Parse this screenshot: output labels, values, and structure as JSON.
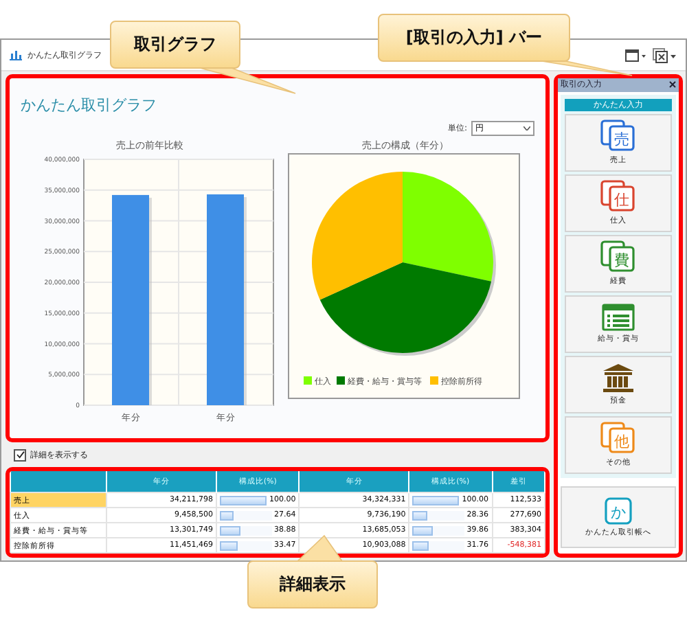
{
  "window": {
    "title": "かんたん取引グラフ"
  },
  "graph_panel": {
    "heading": "かんたん取引グラフ",
    "unit_label": "単位:",
    "unit_select": "円",
    "bar_chart": {
      "title": "売上の前年比較",
      "chart_data": {
        "type": "bar",
        "stacked": false,
        "grid": true,
        "categories": [
          "年分",
          "年分"
        ],
        "ylim": [
          0,
          40000000
        ],
        "yticks": [
          {
            "value": 0,
            "label": "0"
          },
          {
            "value": 5000000,
            "label": "5,000,000"
          },
          {
            "value": 10000000,
            "label": "10,000,000"
          },
          {
            "value": 15000000,
            "label": "15,000,000"
          },
          {
            "value": 20000000,
            "label": "20,000,000"
          },
          {
            "value": 25000000,
            "label": "25,000,000"
          },
          {
            "value": 30000000,
            "label": "30,000,000"
          },
          {
            "value": 35000000,
            "label": "35,000,000"
          },
          {
            "value": 40000000,
            "label": "40,000,000"
          }
        ],
        "series": [
          {
            "color": "#3f8fe6",
            "values": [
              34200000,
              34300000
            ]
          }
        ]
      }
    },
    "pie_chart": {
      "title": "売上の構成（年分）",
      "chart_data": {
        "type": "pie",
        "legend": "bottom",
        "categories": [
          "仕入",
          "経費・給与・賞与等",
          "控除前所得"
        ],
        "values": [
          28.36,
          39.86,
          31.76
        ],
        "colors": [
          "#7fff00",
          "#007a00",
          "#ffbf00"
        ]
      }
    }
  },
  "show_details": {
    "label": "詳細を表示する",
    "checked": true
  },
  "detail_table": {
    "columns": [
      "年分",
      "構成比(%)",
      "年分",
      "構成比(%)",
      "差引"
    ],
    "rows": [
      {
        "label": "売上",
        "selected": true,
        "prior": "34,211,798",
        "prior_ratio": "100.00",
        "prior_bar": {
          "level": 1
        },
        "current": "34,324,331",
        "current_ratio": "100.00",
        "current_bar": {
          "level": 1
        },
        "difference": "112,533",
        "negative": false
      },
      {
        "label": "仕入",
        "selected": false,
        "prior": "9,458,500",
        "prior_ratio": "27.64",
        "prior_bar": {
          "level": 0.2764
        },
        "current": "9,736,190",
        "current_ratio": "28.36",
        "current_bar": {
          "level": 0.2836
        },
        "difference": "277,690",
        "negative": false
      },
      {
        "label": "経費・給与・賞与等",
        "selected": false,
        "prior": "13,301,749",
        "prior_ratio": "38.88",
        "prior_bar": {
          "level": 0.3888
        },
        "current": "13,685,053",
        "current_ratio": "39.86",
        "current_bar": {
          "level": 0.3986
        },
        "difference": "383,304",
        "negative": false
      },
      {
        "label": "控除前所得",
        "selected": false,
        "prior": "11,451,469",
        "prior_ratio": "33.47",
        "prior_bar": {
          "level": 0.3347
        },
        "current": "10,903,088",
        "current_ratio": "31.76",
        "current_bar": {
          "level": 0.3176
        },
        "difference": "-548,381",
        "negative": true
      }
    ]
  },
  "input_bar": {
    "title": "取引の入力",
    "section": "かんたん入力",
    "buttons": [
      {
        "kind": "document",
        "glyph": "売",
        "label": "売上",
        "color": "#2a6fd6"
      },
      {
        "kind": "document",
        "glyph": "仕",
        "label": "仕入",
        "color": "#d9452f"
      },
      {
        "kind": "document",
        "glyph": "費",
        "label": "経費",
        "color": "#2f8f2f"
      },
      {
        "kind": "list",
        "label": "給与・賞与",
        "color": "#2f8f2f"
      },
      {
        "kind": "bank",
        "label": "預金",
        "color": "#6b4a10"
      },
      {
        "kind": "document",
        "glyph": "他",
        "label": "その他",
        "color": "#ee8a1a"
      }
    ],
    "ledger_button": {
      "glyph": "か",
      "label": "かんたん取引帳へ"
    }
  },
  "callouts": [
    {
      "text": "取引グラフ"
    },
    {
      "text": "[取引の入力] バー"
    },
    {
      "text": "詳細表示"
    }
  ]
}
